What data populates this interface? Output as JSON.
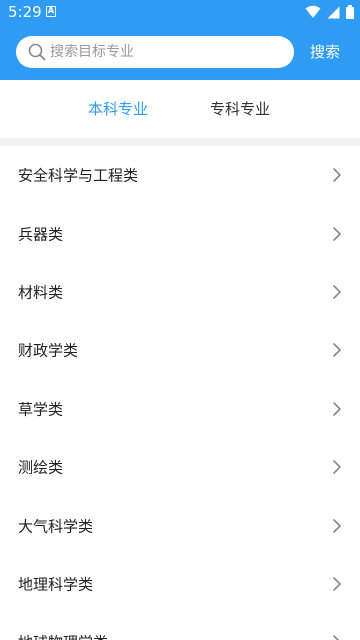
{
  "status_bar": {
    "time": "5:29",
    "notification_icon": "A",
    "icons": [
      "wifi-icon",
      "cellular-icon",
      "battery-icon"
    ]
  },
  "search": {
    "placeholder": "搜索目标专业",
    "value": "",
    "button_label": "搜索",
    "icon": "search-icon"
  },
  "tabs": [
    {
      "label": "本科专业",
      "active": true
    },
    {
      "label": "专科专业",
      "active": false
    }
  ],
  "categories": [
    {
      "label": "安全科学与工程类"
    },
    {
      "label": "兵器类"
    },
    {
      "label": "材料类"
    },
    {
      "label": "财政学类"
    },
    {
      "label": "草学类"
    },
    {
      "label": "测绘类"
    },
    {
      "label": "大气科学类"
    },
    {
      "label": "地理科学类"
    },
    {
      "label": "地球物理学类"
    }
  ],
  "colors": {
    "brand": "#2e9cf5",
    "text": "#222222",
    "chevron": "#888888",
    "separator": "#f2f2f2"
  }
}
